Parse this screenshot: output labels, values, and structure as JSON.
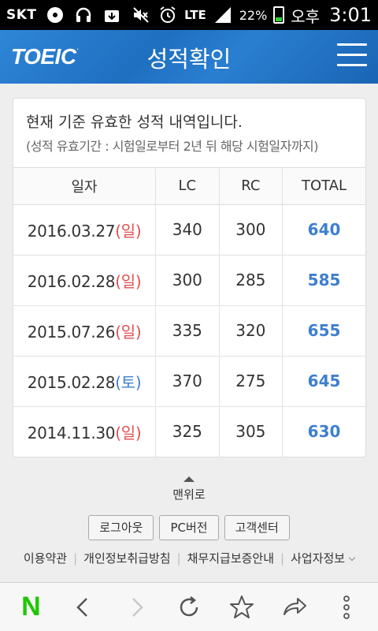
{
  "status_bar": {
    "carrier": "SKT",
    "network": "LTE",
    "battery": "22%",
    "ampm": "오후",
    "time": "3:01"
  },
  "header": {
    "logo": "TOEIC",
    "title": "성적확인"
  },
  "card": {
    "notice": "현재 기준 유효한 성적 내역입니다.",
    "sub_notice": "(성적 유효기간 : 시험일로부터 2년 뒤 해당 시험일자까지)"
  },
  "table": {
    "headers": [
      "일자",
      "LC",
      "RC",
      "TOTAL"
    ],
    "rows": [
      {
        "date": "2016.03.27",
        "dow": "(일)",
        "dow_color": "red",
        "lc": "340",
        "rc": "300",
        "total": "640"
      },
      {
        "date": "2016.02.28",
        "dow": "(일)",
        "dow_color": "red",
        "lc": "300",
        "rc": "285",
        "total": "585"
      },
      {
        "date": "2015.07.26",
        "dow": "(일)",
        "dow_color": "red",
        "lc": "335",
        "rc": "320",
        "total": "655"
      },
      {
        "date": "2015.02.28",
        "dow": "(토)",
        "dow_color": "blue",
        "lc": "370",
        "rc": "275",
        "total": "645"
      },
      {
        "date": "2014.11.30",
        "dow": "(일)",
        "dow_color": "red",
        "lc": "325",
        "rc": "305",
        "total": "630"
      }
    ]
  },
  "footer": {
    "to_top": "맨위로",
    "buttons": [
      "로그아웃",
      "PC버전",
      "고객센터"
    ],
    "links": [
      "이용약관",
      "개인정보취급방침",
      "채무지급보증안내",
      "사업자정보"
    ]
  },
  "colors": {
    "header_blue": "#2a7fd0",
    "total_blue": "#3e7fcf",
    "sunday_red": "#e05050",
    "naver_green": "#1ec800"
  },
  "browser_bar": {
    "icons": [
      "naver-logo-icon",
      "back-icon",
      "forward-icon",
      "refresh-icon",
      "bookmark-star-icon",
      "share-icon",
      "more-icon"
    ],
    "logo": "N"
  }
}
